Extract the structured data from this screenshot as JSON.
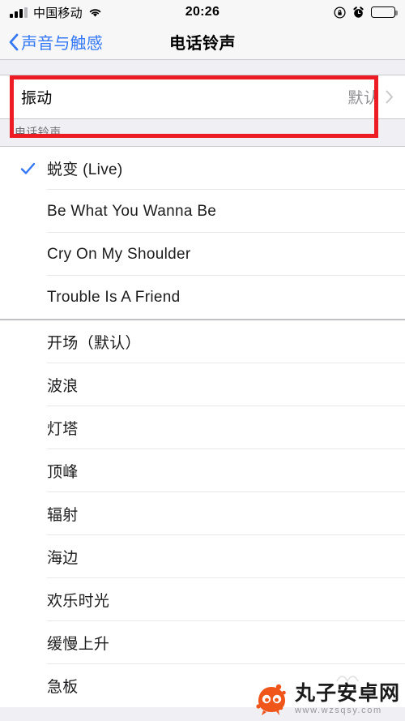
{
  "status_bar": {
    "carrier": "中国移动",
    "time": "20:26",
    "icons": [
      "signal-icon",
      "wifi-icon",
      "rotation-lock-icon",
      "alarm-clock-icon",
      "battery-icon"
    ]
  },
  "nav": {
    "back_label": "声音与触感",
    "title": "电话铃声",
    "back_icon": "chevron-left-icon"
  },
  "vibration": {
    "label": "振动",
    "value": "默认",
    "disclosure_icon": "chevron-right-icon",
    "highlight_color": "#ED1C24"
  },
  "section": {
    "header": "电话铃声"
  },
  "ringtones": {
    "accent_color": "#3478F6",
    "check_icon": "checkmark-icon",
    "custom": [
      {
        "label": "蜕变 (Live)",
        "selected": true
      },
      {
        "label": "Be What You Wanna Be",
        "selected": false
      },
      {
        "label": "Cry On My Shoulder",
        "selected": false
      },
      {
        "label": "Trouble Is A Friend",
        "selected": false
      }
    ],
    "stock": [
      {
        "label": "开场（默认）",
        "selected": false
      },
      {
        "label": "波浪",
        "selected": false
      },
      {
        "label": "灯塔",
        "selected": false
      },
      {
        "label": "顶峰",
        "selected": false
      },
      {
        "label": "辐射",
        "selected": false
      },
      {
        "label": "海边",
        "selected": false
      },
      {
        "label": "欢乐时光",
        "selected": false
      },
      {
        "label": "缓慢上升",
        "selected": false
      },
      {
        "label": "急板",
        "selected": false
      }
    ]
  },
  "watermark": {
    "name": "丸子安卓网",
    "url": "www.wzsqsy.com",
    "color": "#F0551A"
  }
}
